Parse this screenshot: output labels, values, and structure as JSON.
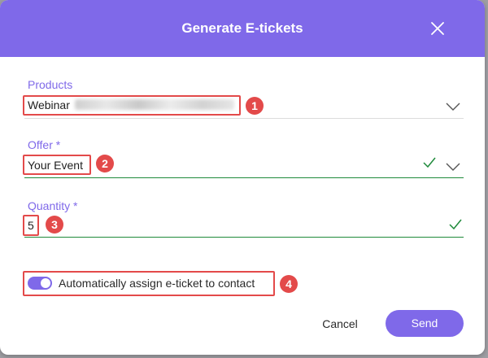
{
  "dialog": {
    "title": "Generate E-tickets",
    "close_icon": "close-icon"
  },
  "colors": {
    "accent": "#7f69e9",
    "valid": "#1f8a3b",
    "highlight": "#e34a4a"
  },
  "fields": {
    "products": {
      "label": "Products",
      "value": "Webinar",
      "icon": "chevron-down-icon"
    },
    "offer": {
      "label": "Offer *",
      "value": "Your Event",
      "valid_icon": "check-icon",
      "icon": "chevron-down-icon"
    },
    "quantity": {
      "label": "Quantity *",
      "value": "5",
      "valid_icon": "check-icon"
    }
  },
  "toggle": {
    "label": "Automatically assign e-ticket to contact",
    "on": true
  },
  "buttons": {
    "cancel": "Cancel",
    "send": "Send"
  },
  "annotations": [
    "1",
    "2",
    "3",
    "4"
  ]
}
